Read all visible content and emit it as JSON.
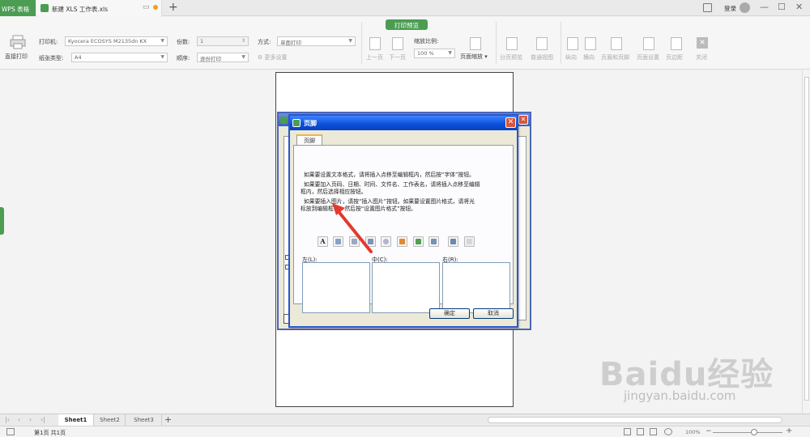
{
  "titlebar": {
    "app_name": "WPS 表格",
    "doc_title": "新建 XLS 工作表.xls",
    "new_tab": "+",
    "login": "登录",
    "minimize": "—",
    "maximize": "☐",
    "close": "✕"
  },
  "ribbon": {
    "mode_label": "打印预览",
    "direct_print": "直接打印",
    "printer_label": "打印机:",
    "printer_value": "Kyocera ECOSYS M2135dn KX",
    "paper_label": "纸张类型:",
    "paper_value": "A4",
    "copies_label": "份数:",
    "copies_value": "1",
    "order_label": "顺序:",
    "order_value": "逐份打印",
    "method_label": "方式:",
    "method_value": "单面打印",
    "more_settings": "更多设置",
    "scale_label": "缩放比例:",
    "scale_value": "100 %",
    "prev_page": "上一页",
    "next_page": "下一页",
    "page_scale": "页面缩放",
    "page_break": "分页预览",
    "normal_view": "普通视图",
    "portrait": "纵向",
    "landscape": "横向",
    "header_footer": "页眉和页脚",
    "page_setup": "页面设置",
    "margins": "页边距",
    "close": "关闭"
  },
  "dialog": {
    "title": "页脚",
    "tab": "页脚",
    "instructions": [
      "如果要设置文本格式，请将插入点移至编辑框内，然后按“字体”按钮。",
      "如果要加入页码、日期、时间、文件名、工作表名，请将插入点移至编辑",
      "框内，然后选择相应按钮。",
      "如果要插入图片，请按“插入图片”按钮。如果要设置图片格式，请将光",
      "标放到编辑框中，然后按“设置图片格式”按钮。"
    ],
    "font_button": "A",
    "left_label": "左(L):",
    "center_label": "中(C):",
    "right_label": "右(R):",
    "ok": "确定",
    "cancel": "取消"
  },
  "sheets": [
    "Sheet1",
    "Sheet2",
    "Sheet3"
  ],
  "status": {
    "page_info": "第1页 共1页",
    "zoom": "100%"
  },
  "watermark": {
    "logo": "Baidu经验",
    "url": "jingyan.baidu.com"
  },
  "colors": {
    "accent": "#4b9d52",
    "dialog_title": "#0a4fd8",
    "arrow": "#e23a2e"
  }
}
